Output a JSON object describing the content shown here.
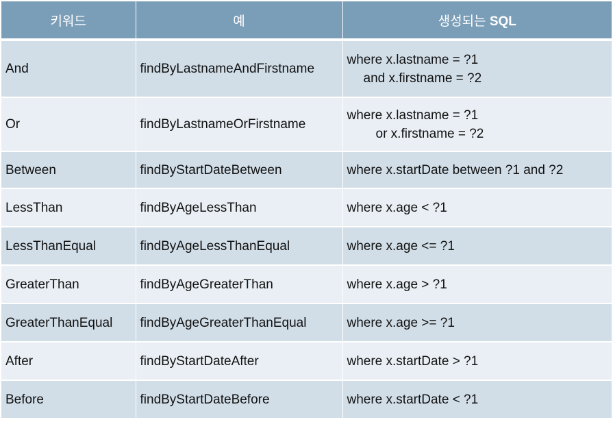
{
  "header": {
    "keyword": "키워드",
    "example": "예",
    "sql_prefix": "생성되는 ",
    "sql_bold": "SQL"
  },
  "rows": [
    {
      "keyword": "And",
      "example": "findByLastnameAndFirstname",
      "sql": "where x.lastname = ?1",
      "sql2": "and x.firstname = ?2"
    },
    {
      "keyword": "Or",
      "example": "findByLastnameOrFirstname",
      "sql": "where x.lastname = ?1",
      "sql2": "or x.firstname = ?2"
    },
    {
      "keyword": "Between",
      "example": "findByStartDateBetween",
      "sql": "where x.startDate between ?1 and ?2"
    },
    {
      "keyword": "LessThan",
      "example": "findByAgeLessThan",
      "sql": "where x.age < ?1"
    },
    {
      "keyword": "LessThanEqual",
      "example": "findByAgeLessThanEqual",
      "sql": "where x.age <= ?1"
    },
    {
      "keyword": "GreaterThan",
      "example": "findByAgeGreaterThan",
      "sql": "where x.age > ?1"
    },
    {
      "keyword": "GreaterThanEqual",
      "example": "findByAgeGreaterThanEqual",
      "sql": "where x.age >= ?1"
    },
    {
      "keyword": "After",
      "example": "findByStartDateAfter",
      "sql": "where x.startDate > ?1"
    },
    {
      "keyword": "Before",
      "example": "findByStartDateBefore",
      "sql": "where x.startDate < ?1"
    }
  ],
  "colors": {
    "header_bg": "#7b9eb8",
    "row_odd_bg": "#d1dee8",
    "row_even_bg": "#e9eff4"
  }
}
